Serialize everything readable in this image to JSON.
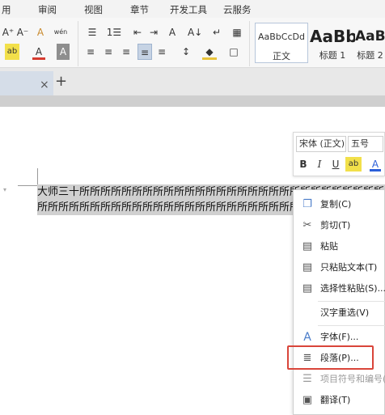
{
  "menubar": {
    "tabs": [
      "用",
      "审阅",
      "视图",
      "章节",
      "开发工具",
      "云服务"
    ]
  },
  "ribbon": {
    "font_size_up": "A⁺",
    "font_size_down": "A⁻",
    "clear_format": "A",
    "pinyin": "wén",
    "bullets": "☰",
    "numbering": "1☰",
    "indent_decrease": "⇤",
    "indent_increase": "⇥",
    "text_effect": "A",
    "sort": "A↓",
    "show_marks": "↵",
    "table": "▦",
    "highlight": "ab",
    "font_color": "A",
    "char_shading": "A",
    "align_left": "≡",
    "align_center": "≡",
    "align_right": "≡",
    "justify": "≡",
    "distribute": "≡",
    "line_spacing": "↕",
    "fill": "◆",
    "border": "□",
    "styles": [
      {
        "sample": "AaBbCcDd",
        "name": "正文"
      },
      {
        "sample": "AaBb",
        "name": "标题 1"
      },
      {
        "sample": "AaB",
        "name": "标题 2"
      }
    ]
  },
  "tabbar": {
    "close": "×",
    "new_tab": "+"
  },
  "document": {
    "line1": "大师三十所所所所所所所所所所所所所所所所所所所所所所所所所所所所所所所所所",
    "line2": "所所所所所所所所所所所所所所所所所所所所所所所所所所所所所所所所所所所所所",
    "margin_mark": "▾"
  },
  "mini_toolbar": {
    "font_name": "宋体 (正文)",
    "font_size": "五号",
    "bold": "B",
    "italic": "I",
    "underline": "U",
    "highlight": "ab",
    "font_color": "A"
  },
  "context_menu": {
    "items": [
      {
        "label": "复制(C)",
        "icon": "copy-icon",
        "glyph": "❐"
      },
      {
        "label": "剪切(T)",
        "icon": "scissors-icon",
        "glyph": "✂"
      },
      {
        "label": "粘贴",
        "icon": "paste-icon",
        "glyph": "▤"
      },
      {
        "label": "只粘贴文本(T)",
        "icon": "paste-text-icon",
        "glyph": "▤"
      },
      {
        "label": "选择性粘贴(S)...",
        "icon": "paste-special-icon",
        "glyph": "▤"
      },
      {
        "label": "汉字重选(V)",
        "icon": "",
        "glyph": ""
      },
      {
        "label": "字体(F)...",
        "icon": "font-icon",
        "glyph": "A"
      },
      {
        "label": "段落(P)...",
        "icon": "paragraph-icon",
        "glyph": "≣"
      },
      {
        "label": "项目符号和编号(",
        "icon": "bullets-icon",
        "glyph": "☰"
      },
      {
        "label": "翻译(T)",
        "icon": "translate-icon",
        "glyph": "▣"
      }
    ]
  },
  "colors": {
    "highlight_box": "#d9453a",
    "selection": "#d0d0d0",
    "tab_active": "#d5dde8"
  }
}
